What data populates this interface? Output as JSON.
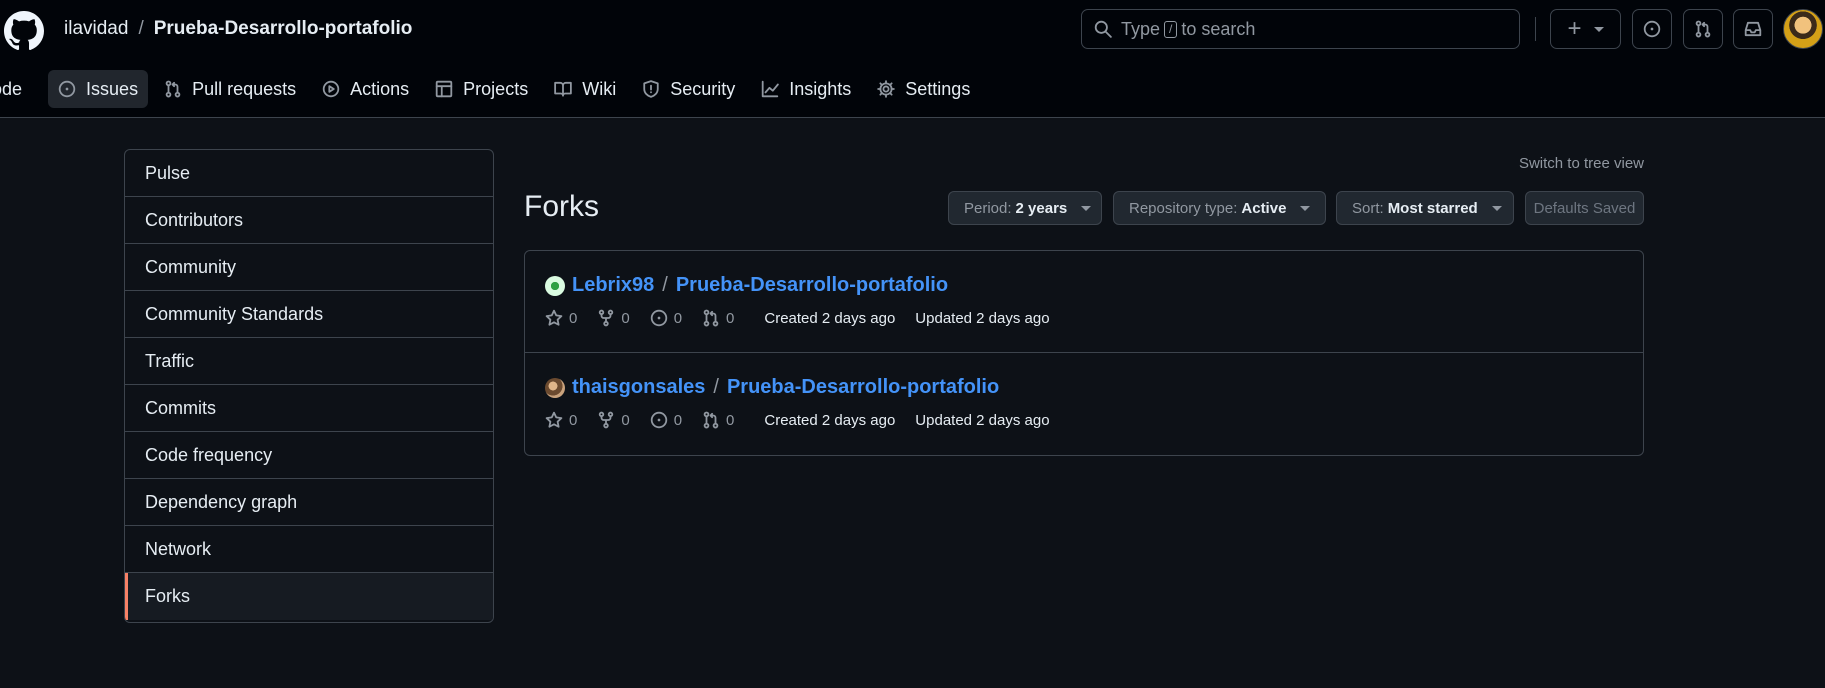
{
  "header": {
    "owner": "ilavidad",
    "separator": "/",
    "repo": "Prueba-Desarrollo-portafolio",
    "search": {
      "before": "Type",
      "key": "/",
      "after": "to search"
    },
    "plus_symbol": "+"
  },
  "tabs": [
    {
      "label": "Code",
      "visible_label": "ode",
      "icon": "code-icon"
    },
    {
      "label": "Issues",
      "icon": "issue-icon"
    },
    {
      "label": "Pull requests",
      "icon": "pull-request-icon"
    },
    {
      "label": "Actions",
      "icon": "play-icon"
    },
    {
      "label": "Projects",
      "icon": "table-icon"
    },
    {
      "label": "Wiki",
      "icon": "book-icon"
    },
    {
      "label": "Security",
      "icon": "shield-icon"
    },
    {
      "label": "Insights",
      "icon": "graph-icon"
    },
    {
      "label": "Settings",
      "icon": "gear-icon"
    }
  ],
  "sidebar": {
    "items": [
      {
        "label": "Pulse"
      },
      {
        "label": "Contributors"
      },
      {
        "label": "Community"
      },
      {
        "label": "Community Standards"
      },
      {
        "label": "Traffic"
      },
      {
        "label": "Commits"
      },
      {
        "label": "Code frequency"
      },
      {
        "label": "Dependency graph"
      },
      {
        "label": "Network"
      },
      {
        "label": "Forks"
      }
    ],
    "selected": "Forks"
  },
  "main": {
    "switch_view": "Switch to tree view",
    "title": "Forks",
    "filters": {
      "period": {
        "label": "Period:",
        "value": "2 years"
      },
      "type": {
        "label": "Repository type:",
        "value": "Active"
      },
      "sort": {
        "label": "Sort:",
        "value": "Most starred"
      }
    },
    "defaults_label": "Defaults Saved",
    "forks": [
      {
        "owner": "Lebrix98",
        "separator": "/",
        "repo": "Prueba-Desarrollo-portafolio",
        "stars": "0",
        "forks": "0",
        "issues": "0",
        "pulls": "0",
        "created": "Created 2 days ago",
        "updated": "Updated 2 days ago"
      },
      {
        "owner": "thaisgonsales",
        "separator": "/",
        "repo": "Prueba-Desarrollo-portafolio",
        "stars": "0",
        "forks": "0",
        "issues": "0",
        "pulls": "0",
        "created": "Created 2 days ago",
        "updated": "Updated 2 days ago"
      }
    ]
  },
  "colors": {
    "background": "#0d1117",
    "header_background": "#010409",
    "link": "#4493f8",
    "selected_accent": "#f78166",
    "border": "#3d444d"
  }
}
